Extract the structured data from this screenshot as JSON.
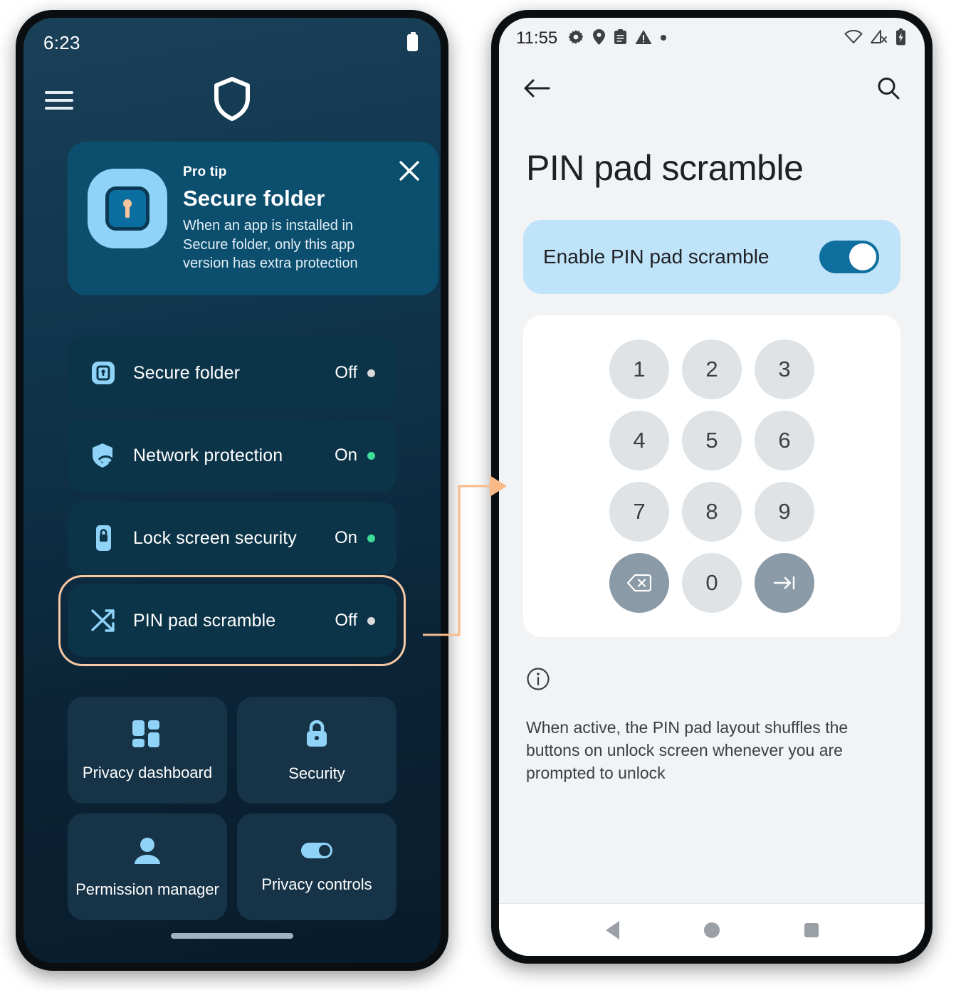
{
  "left_phone": {
    "status_bar": {
      "time": "6:23",
      "battery_icon": "battery-icon"
    },
    "appbar": {
      "menu_icon": "hamburger-menu-icon",
      "logo_icon": "shield-logo-icon"
    },
    "pro_tip": {
      "kicker": "Pro tip",
      "title": "Secure folder",
      "description": "When an app is installed in Secure folder, only this app version has extra protection",
      "close_icon": "close-icon",
      "app_icon": "secure-folder-lock-icon"
    },
    "rows": [
      {
        "icon": "secure-folder-icon",
        "label": "Secure folder",
        "state": "Off",
        "dot_color": "#d9d9d9",
        "highlighted": false
      },
      {
        "icon": "network-shield-wifi-icon",
        "label": "Network protection",
        "state": "On",
        "dot_color": "#3ddc97",
        "highlighted": false
      },
      {
        "icon": "phone-lock-icon",
        "label": "Lock screen security",
        "state": "On",
        "dot_color": "#3ddc97",
        "highlighted": false
      },
      {
        "icon": "shuffle-icon",
        "label": "PIN pad scramble",
        "state": "Off",
        "dot_color": "#d9d9d9",
        "highlighted": true
      }
    ],
    "tiles": [
      {
        "icon": "dashboard-grid-icon",
        "label": "Privacy dashboard"
      },
      {
        "icon": "padlock-icon",
        "label": "Security"
      },
      {
        "icon": "person-icon",
        "label": "Permission manager"
      },
      {
        "icon": "toggle-switch-icon",
        "label": "Privacy controls"
      }
    ],
    "home_indicator": "home-indicator"
  },
  "right_phone": {
    "status_bar": {
      "time": "11:55",
      "left_icons": [
        "gear-icon",
        "location-pin-icon",
        "clipboard-icon",
        "warning-triangle-icon",
        "dot-icon"
      ],
      "right_icons": [
        "wifi-icon",
        "signal-off-icon",
        "battery-charging-icon"
      ]
    },
    "appbar": {
      "back_icon": "back-arrow-icon",
      "search_icon": "search-icon"
    },
    "title": "PIN pad scramble",
    "toggle": {
      "label": "Enable PIN pad scramble",
      "state": "on",
      "name": "enable-pin-pad-scramble-toggle"
    },
    "pinpad": {
      "keys": [
        "1",
        "2",
        "3",
        "4",
        "5",
        "6",
        "7",
        "8",
        "9"
      ],
      "backspace_glyph": "⌫",
      "enter_glyph": "→|",
      "zero": "0"
    },
    "info": {
      "icon": "info-circle-icon",
      "text": "When active, the PIN pad layout shuffles the buttons on unlock screen whenever you are prompted to unlock"
    },
    "navbar": {
      "back": "nav-back-icon",
      "home": "nav-home-icon",
      "recents": "nav-recents-icon"
    }
  },
  "annotation": {
    "connector_color": "#f6bb8c",
    "connector_name": "flow-arrow-connector"
  },
  "colors": {
    "left_bg_top": "#1b4159",
    "left_bg_bottom": "#081b2a",
    "card": "#0c3448",
    "tip_card": "#0c4e6e",
    "tile": "#163347",
    "accent_icon": "#8fd3f8",
    "highlight": "#f6c9a4",
    "right_bg": "#f1f3f4",
    "toggle_track": "#0f6f9e",
    "toggle_card": "#bfe3f9",
    "key_bg": "#dfe3e6",
    "key_alt_bg": "#8b9aa7"
  }
}
